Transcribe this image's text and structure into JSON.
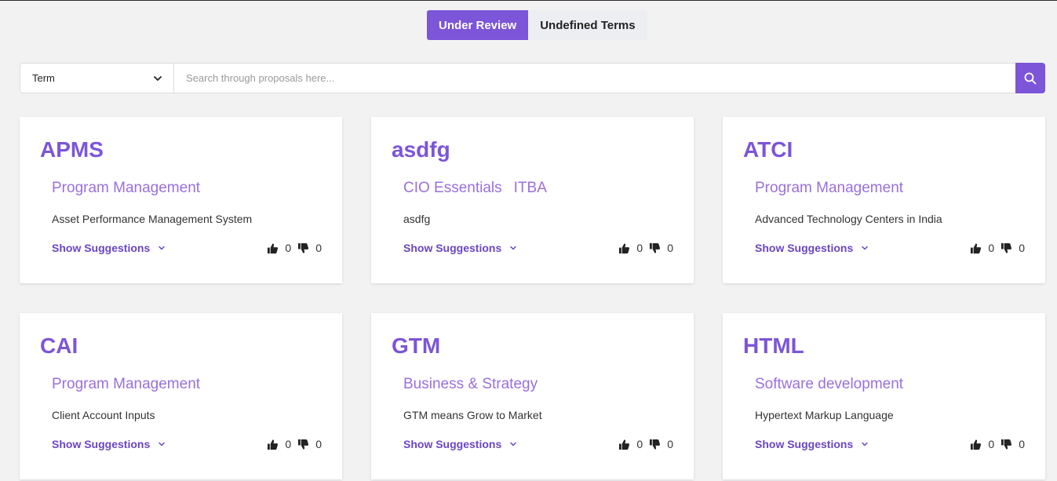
{
  "tabs": [
    {
      "label": "Under Review",
      "active": true
    },
    {
      "label": "Undefined Terms",
      "active": false
    }
  ],
  "search": {
    "filter_value": "Term",
    "placeholder": "Search through proposals here...",
    "button_icon": "search-icon"
  },
  "cards": [
    {
      "term": "APMS",
      "categories": [
        "Program Management"
      ],
      "description": "Asset Performance Management System",
      "suggestions_label": "Show Suggestions",
      "upvotes": "0",
      "downvotes": "0"
    },
    {
      "term": "asdfg",
      "categories": [
        "CIO Essentials",
        "ITBA"
      ],
      "description": "asdfg",
      "suggestions_label": "Show Suggestions",
      "upvotes": "0",
      "downvotes": "0"
    },
    {
      "term": "ATCI",
      "categories": [
        "Program Management"
      ],
      "description": "Advanced Technology Centers in India",
      "suggestions_label": "Show Suggestions",
      "upvotes": "0",
      "downvotes": "0"
    },
    {
      "term": "CAI",
      "categories": [
        "Program Management"
      ],
      "description": "Client Account Inputs",
      "suggestions_label": "Show Suggestions",
      "upvotes": "0",
      "downvotes": "0"
    },
    {
      "term": "GTM",
      "categories": [
        "Business & Strategy"
      ],
      "description": "GTM means Grow to Market",
      "suggestions_label": "Show Suggestions",
      "upvotes": "0",
      "downvotes": "0"
    },
    {
      "term": "HTML",
      "categories": [
        "Software development"
      ],
      "description": "Hypertext Markup Language",
      "suggestions_label": "Show Suggestions",
      "upvotes": "0",
      "downvotes": "0"
    }
  ],
  "colors": {
    "accent": "#7c55d8",
    "category": "#9a6fdf",
    "link": "#6a45c4",
    "background": "#f2f2f3"
  }
}
